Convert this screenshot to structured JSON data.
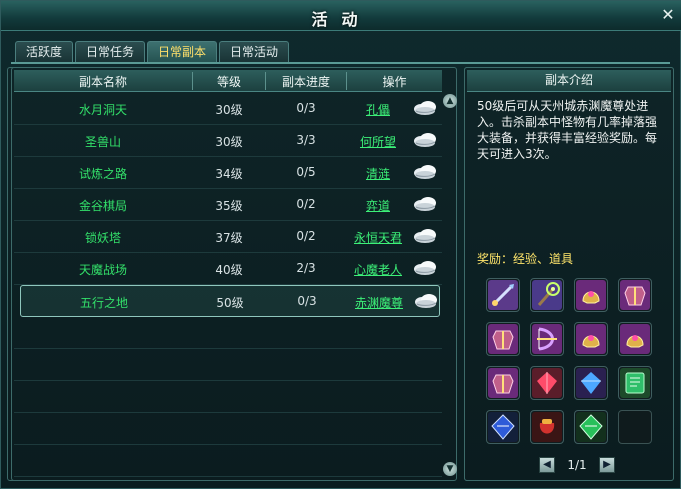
{
  "window": {
    "title": "活动",
    "close_icon": "close-icon"
  },
  "tabs": [
    {
      "label": "活跃度",
      "active": false
    },
    {
      "label": "日常任务",
      "active": false
    },
    {
      "label": "日常副本",
      "active": true
    },
    {
      "label": "日常活动",
      "active": false
    }
  ],
  "table": {
    "headers": [
      "副本名称",
      "等级",
      "副本进度",
      "操作"
    ],
    "rows": [
      {
        "name": "水月洞天",
        "level": "30级",
        "progress": "0/3",
        "action": "孔儡",
        "selected": false
      },
      {
        "name": "圣兽山",
        "level": "30级",
        "progress": "3/3",
        "action": "何所望",
        "selected": false
      },
      {
        "name": "试炼之路",
        "level": "34级",
        "progress": "0/5",
        "action": "清涟",
        "selected": false
      },
      {
        "name": "金谷棋局",
        "level": "35级",
        "progress": "0/2",
        "action": "弈道",
        "selected": false
      },
      {
        "name": "锁妖塔",
        "level": "37级",
        "progress": "0/2",
        "action": "永恒天君",
        "selected": false
      },
      {
        "name": "天魔战场",
        "level": "40级",
        "progress": "2/3",
        "action": "心魔老人",
        "selected": false
      },
      {
        "name": "五行之地",
        "level": "50级",
        "progress": "0/3",
        "action": "赤渊魔尊",
        "selected": true
      }
    ],
    "row_icon": "cloud-fly-icon"
  },
  "intro": {
    "title": "副本介绍",
    "text": "50级后可从天州城赤渊魔尊处进入。击杀副本中怪物有几率掉落强大装备，并获得丰富经验奖励。每天可进入3次。",
    "reward_label": "奖励：经验、道具"
  },
  "rewards": [
    {
      "icon": "sword-item-icon",
      "color": "#5b3a8a"
    },
    {
      "icon": "staff-item-icon",
      "color": "#4a3a8a"
    },
    {
      "icon": "helmet-item-icon",
      "color": "#6a2a7a"
    },
    {
      "icon": "armor-item-icon",
      "color": "#6a2a7a"
    },
    {
      "icon": "armor-item-icon",
      "color": "#6a2a7a"
    },
    {
      "icon": "bow-item-icon",
      "color": "#6a2a7a"
    },
    {
      "icon": "helmet-item-icon",
      "color": "#6a2a7a"
    },
    {
      "icon": "helmet-item-icon",
      "color": "#6a2a7a"
    },
    {
      "icon": "armor-item-icon",
      "color": "#6a2a7a"
    },
    {
      "icon": "red-gem-icon",
      "color": "#5a1d2a"
    },
    {
      "icon": "blue-gem-icon",
      "color": "#2a2050"
    },
    {
      "icon": "book-item-icon",
      "color": "#1d4a2a"
    },
    {
      "icon": "blue-diamond-icon",
      "color": "#13203a"
    },
    {
      "icon": "red-pouch-icon",
      "color": "#3a1515"
    },
    {
      "icon": "green-diamond-icon",
      "color": "#13301d"
    },
    {
      "icon": "empty-slot",
      "color": "#0f1b1d"
    }
  ],
  "pager": {
    "text": "1/1"
  }
}
